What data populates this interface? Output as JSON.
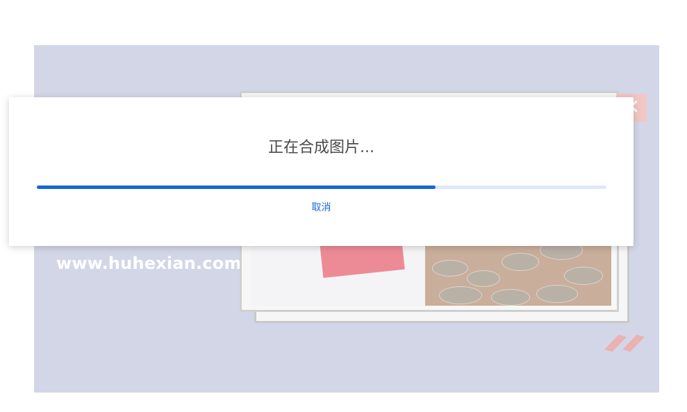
{
  "background": {
    "watermark": "www.huhexian.com",
    "corner_icon": "close-icon"
  },
  "dialog": {
    "title": "正在合成图片...",
    "progress": 0.7,
    "cancel_label": "取消"
  },
  "colors": {
    "backdrop": "#d3d6e6",
    "accent": "#1766d6",
    "progress_track": "#dfe7fb",
    "text": "#4a4a4a"
  }
}
